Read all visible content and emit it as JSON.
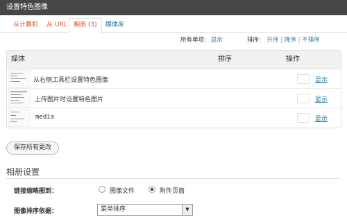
{
  "window": {
    "title": "设置特色图像"
  },
  "tabs": [
    {
      "label": "从计算机"
    },
    {
      "label": "从 URL"
    },
    {
      "label": "相册",
      "count": "(3)"
    },
    {
      "label": "媒体库"
    }
  ],
  "controls": {
    "all_items_label": "所有单项:",
    "show_label": "显示",
    "sort_label": "排序:",
    "sort_asc": "升序",
    "sep1": "|",
    "sort_desc": "降序",
    "sep2": "|",
    "no_sort": "不排序"
  },
  "table": {
    "headers": {
      "media": "媒体",
      "order": "排序",
      "actions": "操作"
    },
    "rows": [
      {
        "title": "从右侧工具栏设置特色图像",
        "action": "显示"
      },
      {
        "title": "上传图片时设置特色图片",
        "action": "显示"
      },
      {
        "title": "media",
        "action": "显示"
      }
    ]
  },
  "save_button": "保存所有更改",
  "gallery_settings": {
    "title": "相册设置",
    "link_label": "链接缩略图到：",
    "link_options": [
      {
        "label": "图像文件",
        "checked": false
      },
      {
        "label": "附件页面",
        "checked": true
      }
    ],
    "order_label": "图像排序依据：",
    "order_value": "菜单排序"
  }
}
